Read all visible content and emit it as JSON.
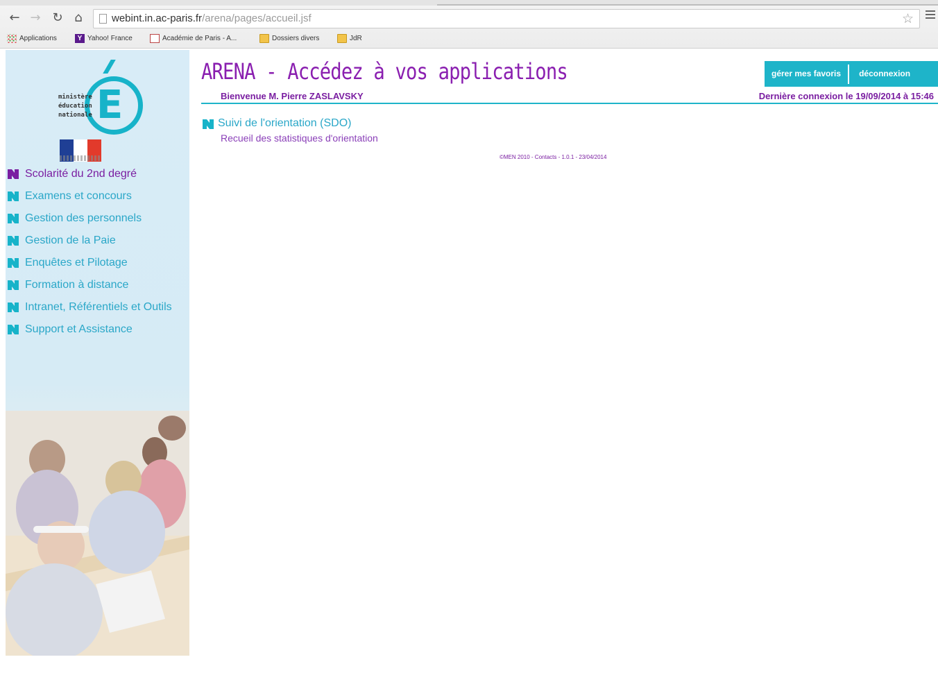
{
  "browser": {
    "url_host": "webint.in.ac-paris.fr",
    "url_path": "/arena/pages/accueil.jsf",
    "bookmarks": [
      {
        "label": "Applications",
        "icon": "apps-grid-icon"
      },
      {
        "label": "Yahoo! France",
        "icon": "yahoo-icon"
      },
      {
        "label": "Académie de Paris - A...",
        "icon": "academie-icon"
      },
      {
        "label": "Dossiers divers",
        "icon": "folder-icon"
      },
      {
        "label": "JdR",
        "icon": "folder-icon"
      }
    ]
  },
  "logo": {
    "lines": [
      "ministère",
      "éducation",
      "nationale"
    ],
    "letter": "E"
  },
  "sidebar": {
    "items": [
      {
        "label": "Scolarité du 2nd degré",
        "active": true
      },
      {
        "label": "Examens et concours"
      },
      {
        "label": "Gestion des personnels"
      },
      {
        "label": "Gestion de la Paie"
      },
      {
        "label": "Enquêtes et Pilotage"
      },
      {
        "label": "Formation à distance"
      },
      {
        "label": "Intranet, Référentiels et Outils"
      },
      {
        "label": "Support et Assistance"
      }
    ]
  },
  "header": {
    "title": "ARENA - Accédez à vos applications",
    "fav_button": "gérer mes favoris",
    "logout_button": "déconnexion",
    "welcome": "Bienvenue M. Pierre ZASLAVSKY",
    "last_connection": "Dernière connexion le 19/09/2014 à 15:46"
  },
  "content": {
    "app_title": "Suivi de l'orientation (SDO)",
    "app_description": "Recueil des statistiques d'orientation",
    "footer": "©MEN 2010 - Contacts - 1.0.1 - 23/04/2014"
  },
  "colors": {
    "purple": "#7a1ea1",
    "teal": "#1eb4c9",
    "link": "#2aa7c8"
  }
}
